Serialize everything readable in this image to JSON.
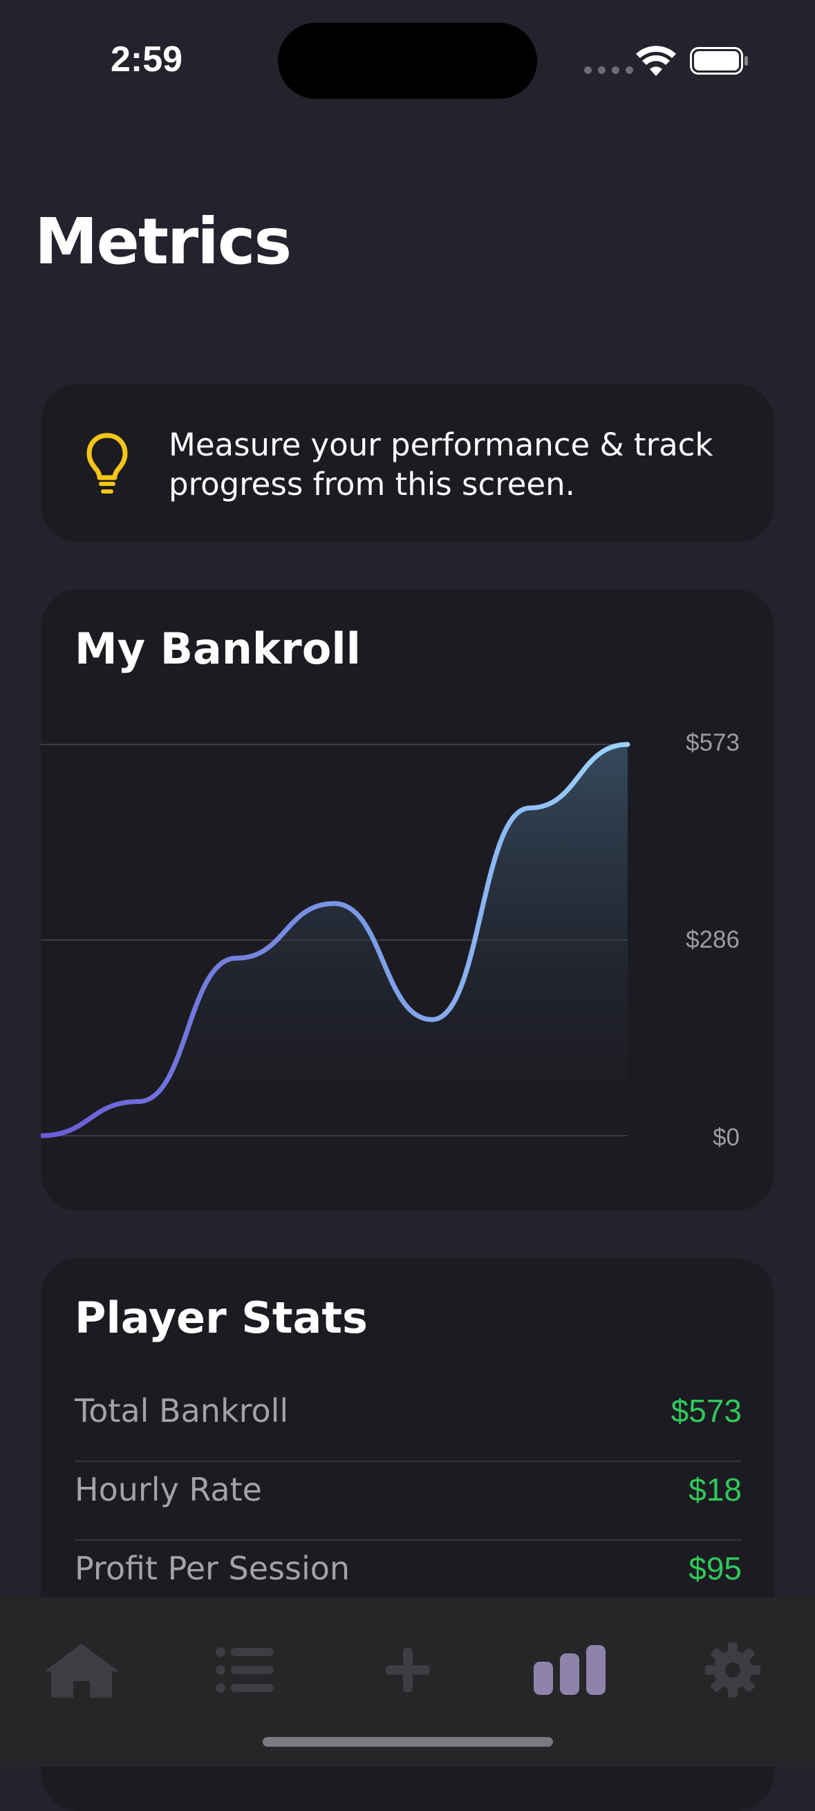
{
  "status_bar": {
    "time": "2:59"
  },
  "page": {
    "title": "Metrics"
  },
  "tip": {
    "text": "Measure your performance & track progress from this screen."
  },
  "bankroll_card": {
    "title": "My Bankroll"
  },
  "chart_data": {
    "type": "area",
    "title": "My Bankroll",
    "x": [
      0,
      1,
      2,
      3,
      4,
      5,
      6,
      7
    ],
    "series": [
      {
        "values": [
          0,
          50,
          260,
          340,
          170,
          480,
          573
        ]
      }
    ],
    "y_ticks": [
      "$573",
      "$286",
      "$0"
    ],
    "ylim": [
      0,
      573
    ],
    "grid": true,
    "colors": {
      "line_start": "#6a5ad6",
      "line_end": "#9ed4ff",
      "grid": "#3e3d45"
    }
  },
  "stats_card": {
    "title": "Player Stats",
    "rows": [
      {
        "label": "Total Bankroll",
        "value": "$573"
      },
      {
        "label": "Hourly Rate",
        "value": "$18"
      },
      {
        "label": "Profit Per Session",
        "value": "$95"
      }
    ]
  },
  "tab_bar": {
    "tabs": [
      {
        "icon": "home-icon",
        "active": false
      },
      {
        "icon": "list-icon",
        "active": false
      },
      {
        "icon": "plus-icon",
        "active": false
      },
      {
        "icon": "bar-chart-icon",
        "active": true
      },
      {
        "icon": "gear-icon",
        "active": false
      }
    ],
    "colors": {
      "inactive": "#3e3d42",
      "active": "#8e84ab"
    }
  }
}
